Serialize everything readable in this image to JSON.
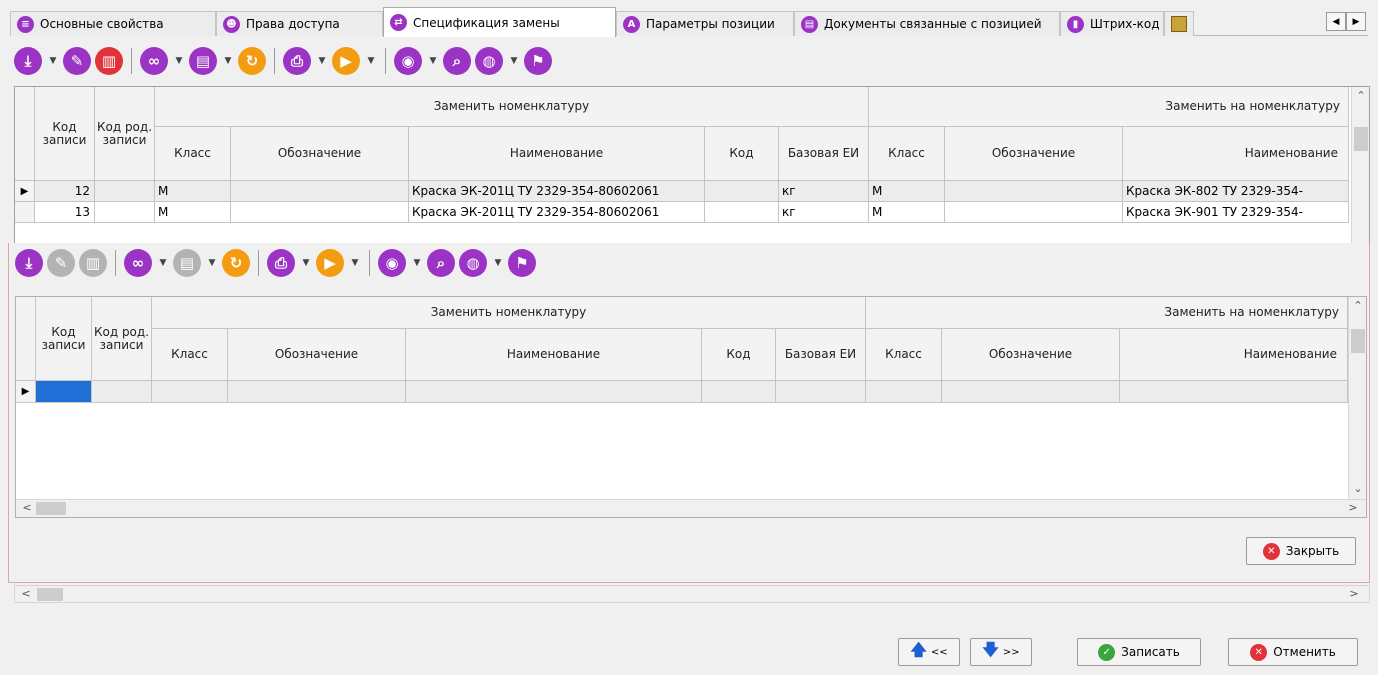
{
  "tabs": [
    {
      "label": "Основные свойства",
      "icon": "list-icon"
    },
    {
      "label": "Права доступа",
      "icon": "user-icon"
    },
    {
      "label": "Спецификация замены",
      "icon": "swap-icon"
    },
    {
      "label": "Параметры позиции",
      "icon": "parameters-icon"
    },
    {
      "label": "Документы связанные с позицией",
      "icon": "document-icon"
    },
    {
      "label": "Штрих-код",
      "icon": "barcode-icon"
    }
  ],
  "grid": {
    "group_replace": "Заменить номенклатуру",
    "group_replace_with": "Заменить на номенклатуру",
    "col_code": "Код записи",
    "col_parent_code": "Код род. записи",
    "col_class": "Класс",
    "col_designation": "Обозначение",
    "col_name": "Наименование",
    "col_kod": "Код",
    "col_unit": "Базовая ЕИ",
    "col_class2": "Класс",
    "col_designation2": "Обозначение",
    "col_name2": "Наименование"
  },
  "rows": [
    {
      "code": "12",
      "parent": "",
      "class": "М",
      "designation": "",
      "name": "Краска ЭК-201Ц ТУ 2329-354-80602061",
      "kod": "",
      "unit": "кг",
      "class2": "М",
      "designation2": "",
      "name2": "Краска ЭК-802 ТУ 2329-354-"
    },
    {
      "code": "13",
      "parent": "",
      "class": "М",
      "designation": "",
      "name": "Краска ЭК-201Ц ТУ 2329-354-80602061",
      "kod": "",
      "unit": "кг",
      "class2": "М",
      "designation2": "",
      "name2": "Краска ЭК-901 ТУ 2329-354-"
    }
  ],
  "buttons": {
    "close": "Закрыть",
    "prev": "<<",
    "next": ">>",
    "save": "Записать",
    "cancel": "Отменить"
  },
  "colors": {
    "accent": "#9b34c4",
    "orange": "#f39c12",
    "delete": "#e0343a",
    "ok": "#3aa53a",
    "nav": "#1f5fd1"
  }
}
